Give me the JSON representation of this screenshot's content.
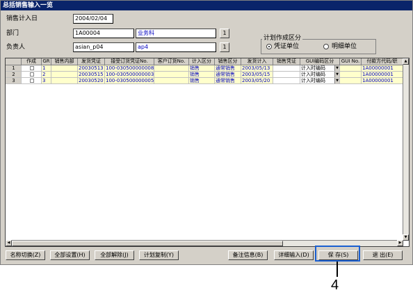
{
  "window": {
    "title": "总括销售输入一览"
  },
  "form": {
    "sales_date_label": "销售计入日",
    "sales_date_value": "2004/02/04",
    "dept_label": "部门",
    "dept_code": "1A00004",
    "dept_name": "业务科",
    "person_label": "负责人",
    "person_code": "asian_p04",
    "person_name": "ap4",
    "lookup_label": "1",
    "plan_group_title": "计划作成区分",
    "radio_voucher": "凭证单位",
    "radio_detail": "明细单位",
    "radio_selected": "凭证单位"
  },
  "grid": {
    "headers": [
      "",
      "作成",
      "GR",
      "销售内部",
      "发货凭证",
      "接受订货凭证No.",
      "客户订货No.",
      "计入区分",
      "销售区分",
      "发货计入",
      "销售凭证",
      "GUI编码区分",
      "GUI No.",
      "付款方代码/职"
    ],
    "rows": [
      {
        "num": "1",
        "gr": "1",
        "ship": "20030513",
        "order": "100-030500000008",
        "cust": "",
        "entry": "销售",
        "sales_type": "通常销售",
        "ship_date": "2003/05/13",
        "voucher": "",
        "gui_type": "计入时编码",
        "gui_no": "",
        "payer": "1A00000001"
      },
      {
        "num": "2",
        "gr": "2",
        "ship": "20030515",
        "order": "100-030500000003",
        "cust": "",
        "entry": "销售",
        "sales_type": "通常销售",
        "ship_date": "2003/05/15",
        "voucher": "",
        "gui_type": "计入时编码",
        "gui_no": "",
        "payer": "1A00000001"
      },
      {
        "num": "3",
        "gr": "3",
        "ship": "20030520",
        "order": "100-030500000005",
        "cust": "",
        "entry": "销售",
        "sales_type": "通常销售",
        "ship_date": "2003/05/20",
        "voucher": "",
        "gui_type": "计入时编码",
        "gui_no": "",
        "payer": "1A00000001"
      }
    ]
  },
  "buttons": {
    "name_switch": "名称切换(Z)",
    "select_all": "全部设置(H)",
    "deselect_all": "全部解除(J)",
    "plan_copy": "计划复制(Y)",
    "note_info": "备注信息(B)",
    "detail_input": "详细输入(D)",
    "save": "保 存(S)",
    "exit": "退 出(E)"
  },
  "callout": {
    "number": "4"
  },
  "colors": {
    "title_bar": "#0a246a",
    "highlight": "#1a5fd1",
    "row_yellow": "#ffffcc",
    "blue_text": "#0000c0"
  }
}
